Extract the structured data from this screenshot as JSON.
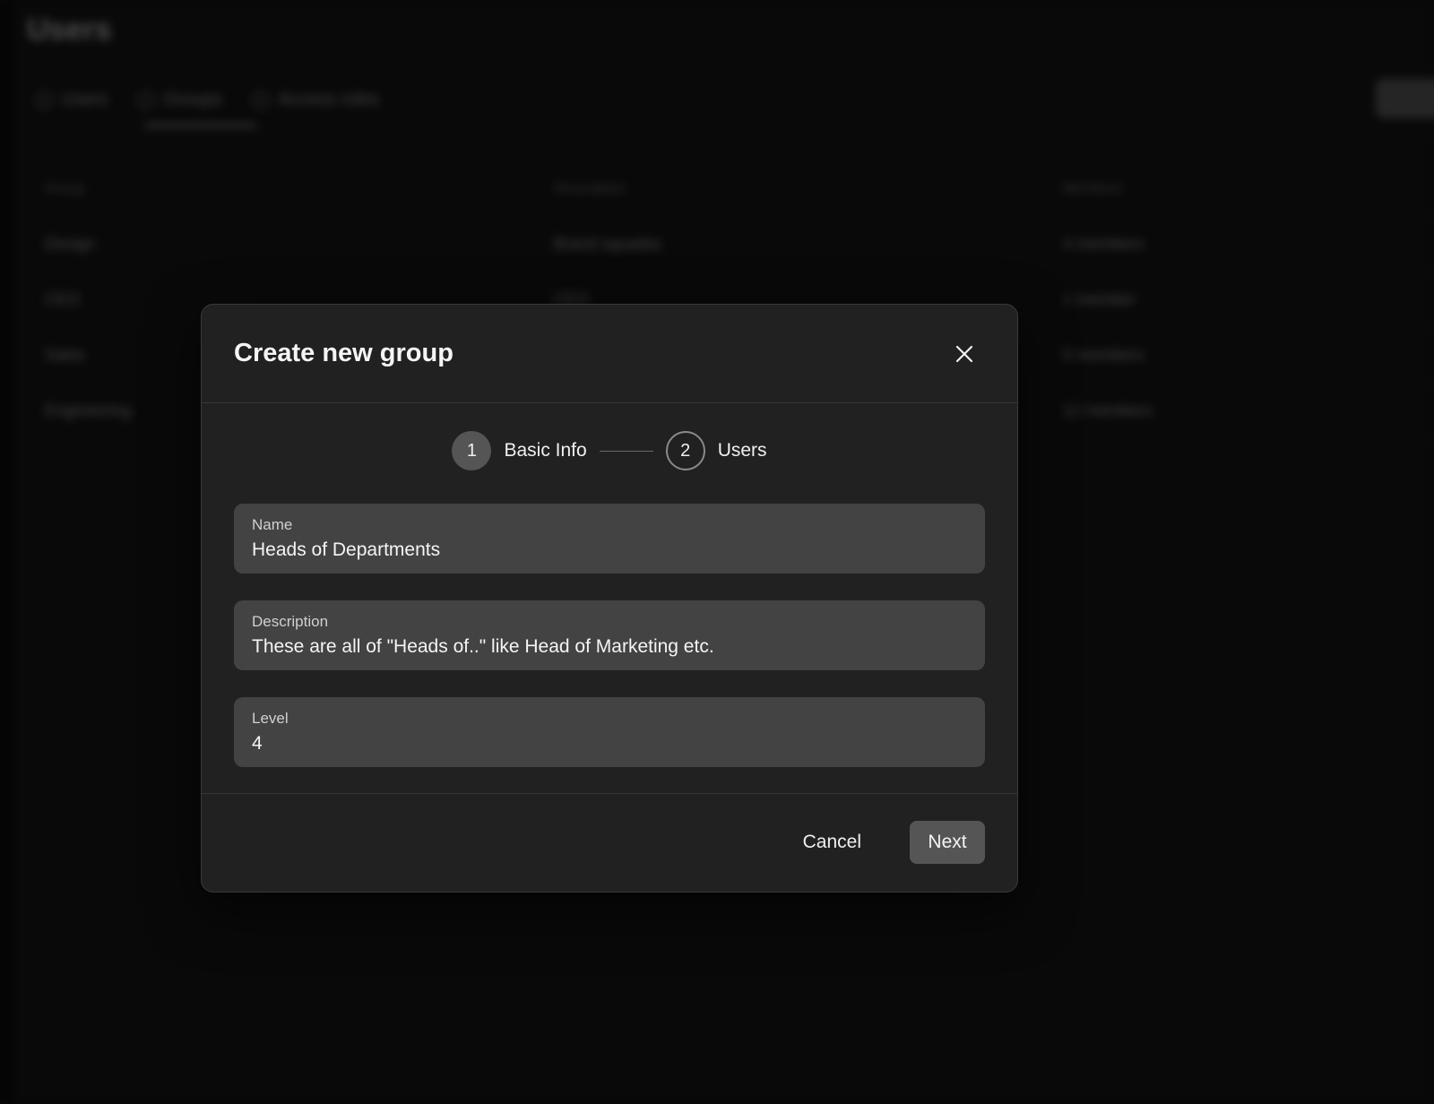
{
  "background": {
    "title": "Users",
    "tabs": [
      {
        "label": "Users"
      },
      {
        "label": "Groups"
      },
      {
        "label": "Access roles"
      }
    ],
    "table": {
      "headers": [
        "Group",
        "Description",
        "Members"
      ],
      "rows": [
        [
          "Design",
          "Brand squadss",
          "4 members"
        ],
        [
          "CEO",
          "CEO",
          "1 member"
        ],
        [
          "Sales",
          "",
          "5 members"
        ],
        [
          "Engineering",
          "",
          "12 members"
        ]
      ]
    }
  },
  "modal": {
    "title": "Create new group",
    "close_icon": "close-icon",
    "stepper": {
      "steps": [
        {
          "number": "1",
          "label": "Basic Info",
          "state": "active"
        },
        {
          "number": "2",
          "label": "Users",
          "state": "inactive"
        }
      ]
    },
    "fields": {
      "name": {
        "label": "Name",
        "value": "Heads of Departments"
      },
      "description": {
        "label": "Description",
        "value": "These are all of \"Heads of..\" like Head of Marketing etc."
      },
      "level": {
        "label": "Level",
        "value": "4"
      }
    },
    "footer": {
      "cancel_label": "Cancel",
      "next_label": "Next"
    }
  },
  "colors": {
    "modal_bg": "#212121",
    "field_bg": "#434343",
    "primary_button": "#555555",
    "page_bg": "#0e0e0e"
  }
}
